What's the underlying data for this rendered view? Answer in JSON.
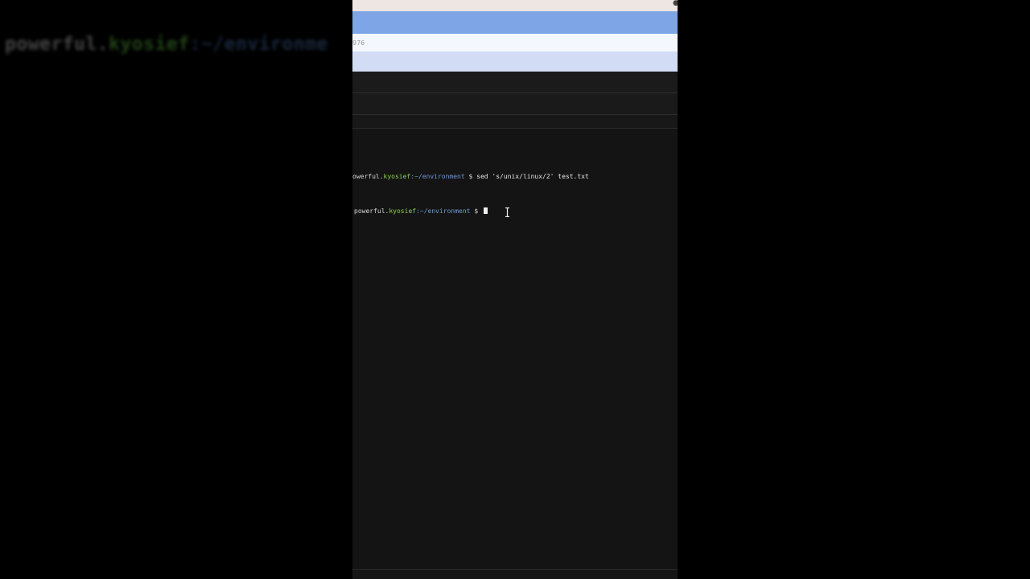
{
  "background_prompt": {
    "user": "powerful.",
    "host": "kyosief",
    "path": ":~/environme"
  },
  "browser": {
    "address_fragment": "976"
  },
  "terminal": {
    "lines": [
      {
        "user": "owerful.",
        "host": "kyosief",
        "path": ":~/environment",
        "symbol": " $ ",
        "command": "sed 's/unix/linux/2' test.txt"
      },
      {
        "user": "powerful.",
        "host": "kyosief",
        "path": ":~/environment",
        "symbol": " $ ",
        "command": ""
      }
    ]
  },
  "colors": {
    "host": "#8fd14f",
    "path": "#6f9bd1",
    "tab_bar": "#7ea6e6",
    "terminal_bg": "#141414"
  },
  "icons": {
    "text_cursor": "i-beam-cursor-icon"
  }
}
